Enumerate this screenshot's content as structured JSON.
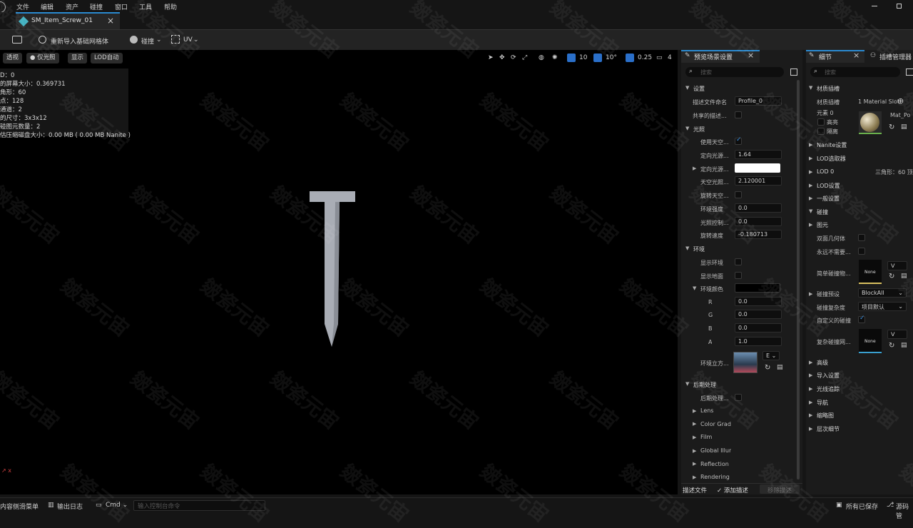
{
  "menu": [
    "文件",
    "编辑",
    "资产",
    "碰撞",
    "窗口",
    "工具",
    "帮助"
  ],
  "tab": {
    "title": "SM_Item_Screw_01",
    "close": "×"
  },
  "toolbar": {
    "reimport": "重新导入基础网格体",
    "collision": "碰撞",
    "uv": "UV"
  },
  "viewport": {
    "buttons": [
      "透视",
      "仅光照",
      "显示",
      "LOD自动"
    ],
    "grid_value": "10",
    "angle_value": "10°",
    "scale_value": "0.25",
    "camera_value": "4",
    "stats": [
      "D：0",
      "的屏幕大小：0.369731",
      "角形：60",
      "点：128",
      "通道：2",
      "的尺寸：3x3x12",
      "碰图元数量：2",
      "估压缩磁盘大小：0.00 MB ( 0.00 MB Nanite )"
    ]
  },
  "preview_panel": {
    "title": "预览场景设置",
    "search_placeholder": "搜索",
    "section_settings": "设置",
    "profile_label": "描述文件命名",
    "profile_value": "Profile_0",
    "shared_label": "共享的描述...",
    "section_lighting": "光照",
    "use_sky_label": "使用天空...",
    "dir_intensity_label": "定向光源...",
    "dir_intensity_value": "1.64",
    "dir_color_label": "定向光源...",
    "sky_intensity_label": "天空光照...",
    "sky_intensity_value": "2.120001",
    "rotate_sky_label": "旋转天空...",
    "env_intensity_label": "环境强度",
    "env_intensity_value": "0.0",
    "light_control_label": "光照控制...",
    "light_control_value": "0.0",
    "rotation_speed_label": "旋转速度",
    "rotation_speed_value": "-0.180713",
    "section_env": "环境",
    "show_env_label": "显示环境",
    "show_floor_label": "显示地面",
    "env_color_label": "环境颜色",
    "r_label": "R",
    "r_value": "0.0",
    "g_label": "G",
    "g_value": "0.0",
    "b_label": "B",
    "b_value": "0.0",
    "a_label": "A",
    "a_value": "1.0",
    "env_cubemap_label": "环境立方...",
    "env_cubemap_dropdown": "E",
    "section_post": "后期处理",
    "post_label": "后期处理...",
    "sub_sections": [
      "Lens",
      "Color Grad",
      "Film",
      "Global Illur",
      "Reflection",
      "Rendering"
    ],
    "profile_footer": "描述文件",
    "add_profile": "添加描述",
    "remove_profile": "移除描述"
  },
  "details_panel": {
    "tab_details": "细节",
    "tab_plugin": "插槽管理器",
    "search_placeholder": "搜索",
    "material_slots_section": "材质插槽",
    "material_slots_label": "材质插槽",
    "material_slots_value": "1 Material Slot",
    "element_label": "元素 0",
    "highlight_label": "高亮",
    "isolate_label": "隔离",
    "material_name": "Mat_Po",
    "nanite": "Nanite设置",
    "lod_picker": "LOD选取器",
    "lod0": "LOD 0",
    "lod0_info": "三角形：60  顶",
    "lod_settings": "LOD设置",
    "general": "一般设置",
    "collision": "碰撞",
    "primitive": "图元",
    "double_sided": "双面几何体",
    "never_need": "永远不需要...",
    "simple_collision": "简单碰撞物...",
    "none1": "None",
    "collision_preset_label": "碰撞预设",
    "collision_preset_value": "BlockAll",
    "collision_complexity_label": "碰撞复杂度",
    "collision_complexity_value": "项目默认",
    "custom_collision_label": "自定义的碰撞",
    "complex_collision_label": "复杂碰撞网...",
    "none2": "None",
    "advanced": "高级",
    "import_settings": "导入设置",
    "raytracing": "光线追踪",
    "navigation": "导航",
    "thumbnail": "缩略图",
    "hlod": "层次细节"
  },
  "statusbar": {
    "content_drawer": "内容侧滑菜单",
    "output_log": "输出日志",
    "cmd": "Cmd",
    "console_placeholder": "输入控制台命令",
    "saved": "所有已保存",
    "source": "源码管"
  },
  "watermark": "皴瓷元宙"
}
